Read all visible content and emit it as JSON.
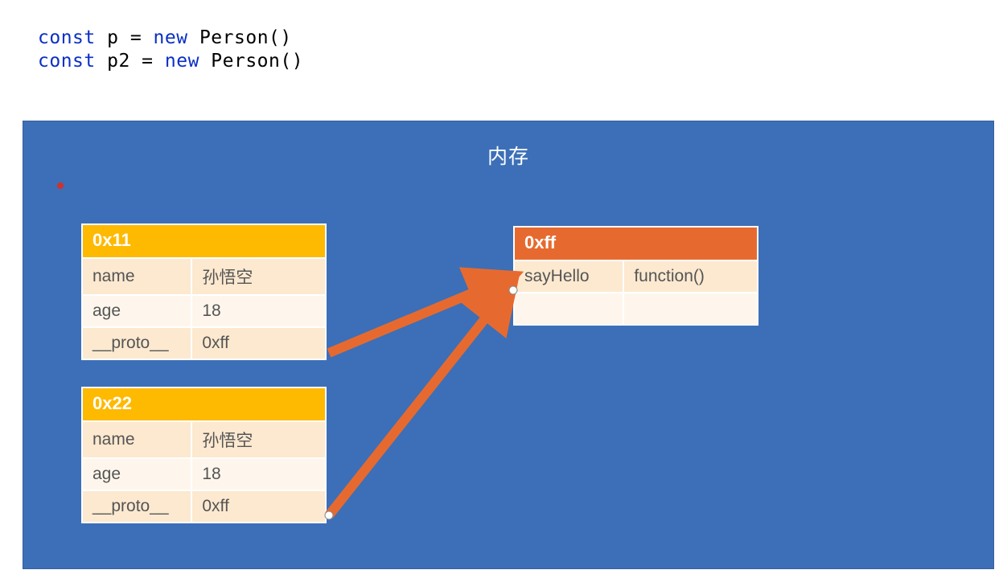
{
  "code": {
    "line1": {
      "const": "const",
      "ident": "p",
      "eq": "=",
      "new": "new",
      "cls": "Person",
      "paren": "()"
    },
    "line2": {
      "const": "const",
      "ident": "p2",
      "eq": "=",
      "new": "new",
      "cls": "Person",
      "paren": "()"
    }
  },
  "memory": {
    "title": "内存"
  },
  "objects": {
    "o1": {
      "addr": "0x11",
      "rows": [
        {
          "k": "name",
          "v": "孙悟空"
        },
        {
          "k": "age",
          "v": "18"
        },
        {
          "k": "__proto__",
          "v": "0xff"
        }
      ]
    },
    "o2": {
      "addr": "0x22",
      "rows": [
        {
          "k": "name",
          "v": "孙悟空"
        },
        {
          "k": "age",
          "v": "18"
        },
        {
          "k": "__proto__",
          "v": "0xff"
        }
      ]
    },
    "proto": {
      "addr": "0xff",
      "rows": [
        {
          "k": "sayHello",
          "v": "function()"
        },
        {
          "k": "",
          "v": ""
        }
      ]
    }
  }
}
